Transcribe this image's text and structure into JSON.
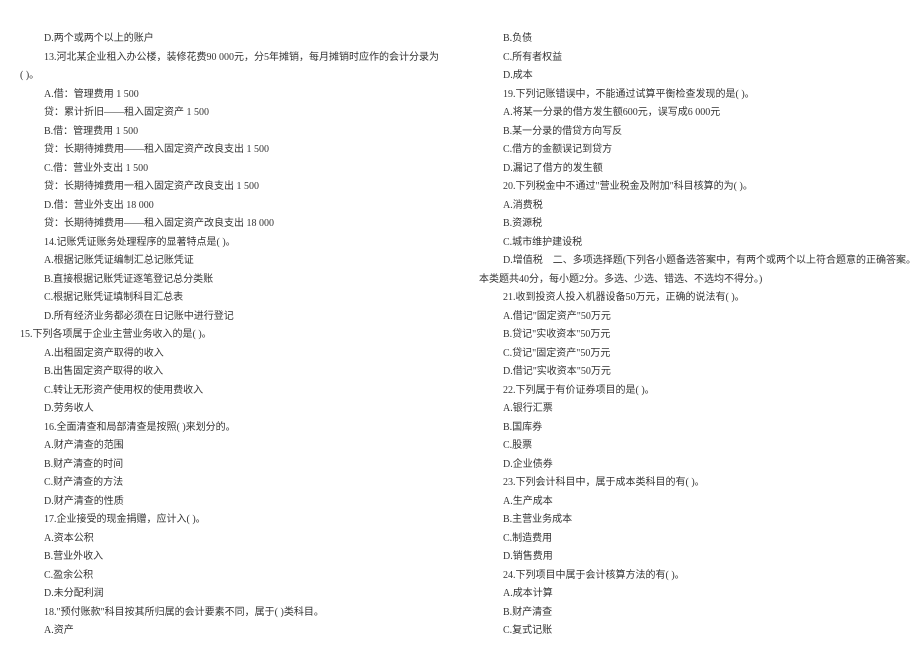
{
  "left": [
    {
      "cls": "indent1",
      "t": "D.两个或两个以上的账户"
    },
    {
      "cls": "indent1",
      "t": "13.河北某企业租入办公楼，装修花费90 000元，分5年摊销，每月摊销时应作的会计分录为"
    },
    {
      "cls": "indent0",
      "t": "( )。"
    },
    {
      "cls": "indent1",
      "t": "A.借：管理费用 1 500"
    },
    {
      "cls": "indent1",
      "t": "贷：累计折旧——租入固定资产 1 500"
    },
    {
      "cls": "indent1",
      "t": "B.借：管理费用 1 500"
    },
    {
      "cls": "indent1",
      "t": "贷：长期待摊费用——租入固定资产改良支出 1 500"
    },
    {
      "cls": "indent1",
      "t": "C.借：营业外支出 1 500"
    },
    {
      "cls": "indent1",
      "t": "贷：长期待摊费用一租入固定资产改良支出 1 500"
    },
    {
      "cls": "indent1",
      "t": "D.借：营业外支出 18 000"
    },
    {
      "cls": "indent1",
      "t": "贷：长期待摊费用——租入固定资产改良支出 18 000"
    },
    {
      "cls": "indent1",
      "t": "14.记账凭证账务处理程序的显著特点是( )。"
    },
    {
      "cls": "indent1",
      "t": "A.根据记账凭证编制汇总记账凭证"
    },
    {
      "cls": "indent1",
      "t": "B.直接根据记账凭证逐笔登记总分类账"
    },
    {
      "cls": "indent1",
      "t": "C.根据记账凭证填制科目汇总表"
    },
    {
      "cls": "indent1",
      "t": "D.所有经济业务都必须在日记账中进行登记"
    },
    {
      "cls": "indent0",
      "t": "15.下列各项属于企业主营业务收入的是( )。"
    },
    {
      "cls": "indent1",
      "t": "A.出租固定资产取得的收入"
    },
    {
      "cls": "indent1",
      "t": "B.出售固定资产取得的收入"
    },
    {
      "cls": "indent1",
      "t": "C.转让无形资产使用权的使用费收入"
    },
    {
      "cls": "indent1",
      "t": "D.劳务收人"
    },
    {
      "cls": "indent1",
      "t": "16.全面清查和局部清查是按照( )来划分的。"
    },
    {
      "cls": "indent1",
      "t": "A.财产清查的范围"
    },
    {
      "cls": "indent1",
      "t": "B.财产清查的时间"
    },
    {
      "cls": "indent1",
      "t": "C.财产清查的方法"
    },
    {
      "cls": "indent1",
      "t": "D.财产清查的性质"
    },
    {
      "cls": "indent1",
      "t": "17.企业接受的现金捐赠，应计入( )。"
    },
    {
      "cls": "indent1",
      "t": "A.资本公积"
    },
    {
      "cls": "indent1",
      "t": "B.营业外收入"
    },
    {
      "cls": "indent1",
      "t": "C.盈余公积"
    },
    {
      "cls": "indent1",
      "t": "D.未分配利润"
    },
    {
      "cls": "indent1",
      "t": "18.\"预付账款\"科目按其所归属的会计要素不同，属于( )类科目。"
    },
    {
      "cls": "indent1",
      "t": "A.资产"
    }
  ],
  "right": [
    {
      "cls": "indent1",
      "t": "B.负债"
    },
    {
      "cls": "indent1",
      "t": "C.所有者权益"
    },
    {
      "cls": "indent1",
      "t": "D.成本"
    },
    {
      "cls": "indent1",
      "t": "19.下列记账错误中，不能通过试算平衡检查发现的是( )。"
    },
    {
      "cls": "indent1",
      "t": "A.将某一分录的借方发生额600元，误写成6 000元"
    },
    {
      "cls": "indent1",
      "t": "B.某一分录的借贷方向写反"
    },
    {
      "cls": "indent1",
      "t": "C.借方的金额误记到贷方"
    },
    {
      "cls": "indent1",
      "t": "D.漏记了借方的发生额"
    },
    {
      "cls": "indent1",
      "t": "20.下列税金中不通过\"营业税金及附加\"科目核算的为( )。"
    },
    {
      "cls": "indent1",
      "t": "A.消费税"
    },
    {
      "cls": "indent1",
      "t": "B.资源税"
    },
    {
      "cls": "indent1",
      "t": "C.城市维护建设税"
    },
    {
      "cls": "indent1",
      "t": "D.增值税　二、多项选择题(下列各小题备选答案中，有两个或两个以上符合题意的正确答案。"
    },
    {
      "cls": "indent0",
      "t": "本类题共40分，每小题2分。多选、少选、错选、不选均不得分。)"
    },
    {
      "cls": "indent1",
      "t": "21.收到投资人投入机器设备50万元，正确的说法有( )。"
    },
    {
      "cls": "indent1",
      "t": "A.借记\"固定资产\"50万元"
    },
    {
      "cls": "indent1",
      "t": "B.贷记\"实收资本\"50万元"
    },
    {
      "cls": "indent1",
      "t": "C.贷记\"固定资产\"50万元"
    },
    {
      "cls": "indent1",
      "t": "D.借记\"实收资本\"50万元"
    },
    {
      "cls": "indent1",
      "t": "22.下列属于有价证券项目的是( )。"
    },
    {
      "cls": "indent1",
      "t": "A.银行汇票"
    },
    {
      "cls": "indent1",
      "t": "B.国库券"
    },
    {
      "cls": "indent1",
      "t": "C.股票"
    },
    {
      "cls": "indent1",
      "t": "D.企业债券"
    },
    {
      "cls": "indent1",
      "t": "23.下列会计科目中，属于成本类科目的有( )。"
    },
    {
      "cls": "indent1",
      "t": "A.生产成本"
    },
    {
      "cls": "indent1",
      "t": "B.主营业务成本"
    },
    {
      "cls": "indent1",
      "t": "C.制造费用"
    },
    {
      "cls": "indent1",
      "t": "D.销售费用"
    },
    {
      "cls": "indent1",
      "t": "24.下列项目中属于会计核算方法的有( )。"
    },
    {
      "cls": "indent1",
      "t": "A.成本计算"
    },
    {
      "cls": "indent1",
      "t": "B.财产清查"
    },
    {
      "cls": "indent1",
      "t": "C.复式记账"
    }
  ]
}
